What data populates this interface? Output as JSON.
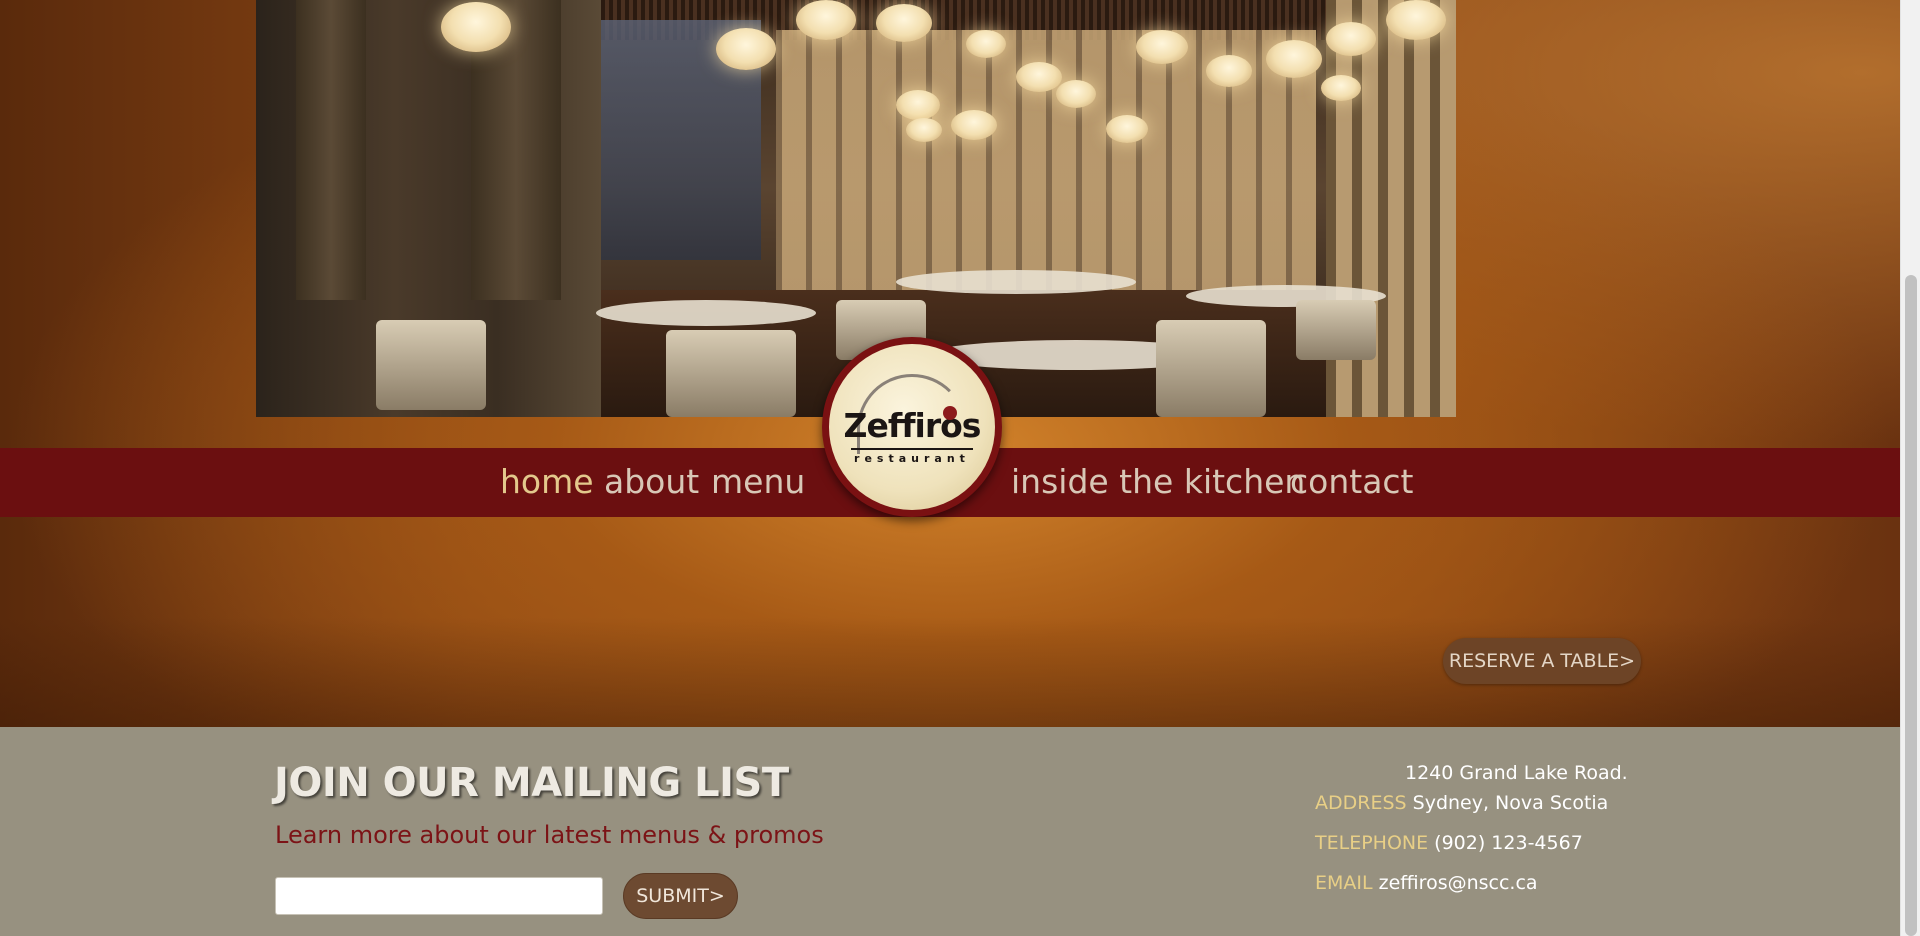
{
  "nav": {
    "items": [
      {
        "label": "home",
        "active": true
      },
      {
        "label": "about",
        "active": false
      },
      {
        "label": "menu",
        "active": false
      },
      {
        "label": "inside the kitchen",
        "active": false
      },
      {
        "label": "contact",
        "active": false
      }
    ]
  },
  "logo": {
    "name": "Zeffiros",
    "subtitle": "restaurant"
  },
  "reserve_button": "RESERVE A TABLE>",
  "mailing": {
    "heading": "JOIN OUR MAILING LIST",
    "subheading": "Learn more about our latest menus & promos",
    "input_value": "",
    "submit_label": "SUBMIT>"
  },
  "contact": {
    "address_line1": "1240 Grand Lake Road.",
    "address_label": "ADDRESS",
    "address_line2": "Sydney, Nova Scotia",
    "telephone_label": "TELEPHONE",
    "telephone": "(902) 123-4567",
    "email_label": "EMAIL",
    "email": "zeffiros@nscc.ca"
  },
  "colors": {
    "nav_band": "#6b0f10",
    "nav_active": "#e3c88c",
    "footer_bg": "#979180",
    "subheading": "#7c1316",
    "contact_label": "#e8cf86"
  },
  "hero_image": "restaurant dining room interior photo"
}
